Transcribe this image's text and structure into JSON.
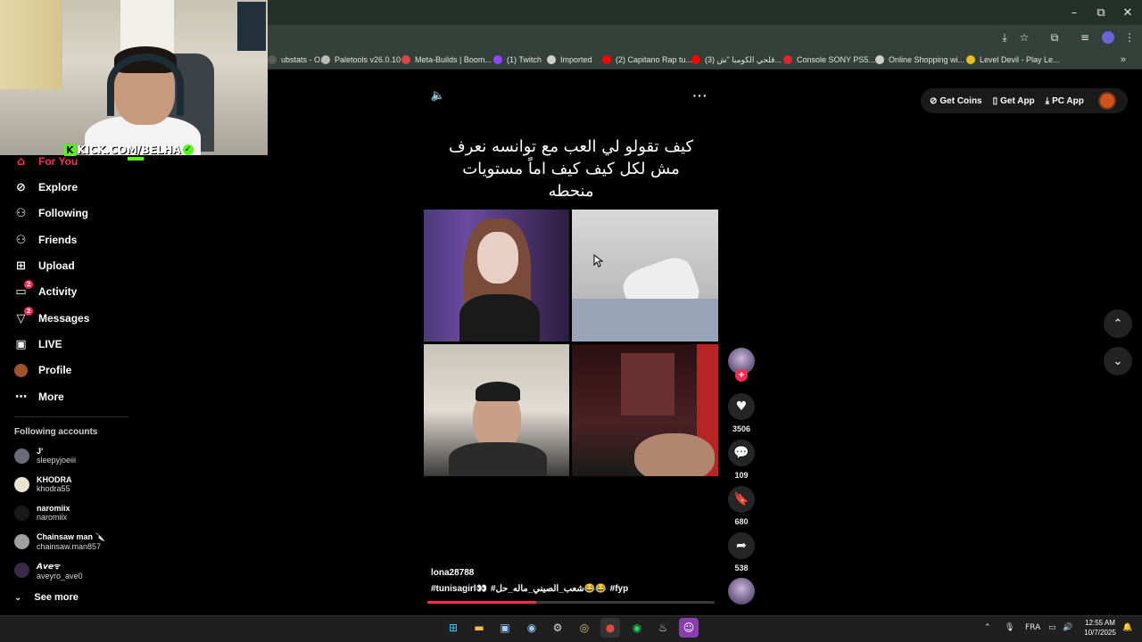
{
  "window": {
    "minimize": "–",
    "restore": "⧉",
    "close": "✕"
  },
  "bookmarks": [
    {
      "label": "ubstats - O...",
      "color": "#5a5a5a"
    },
    {
      "label": "Paletools v26.0.10",
      "color": "#bbbbbb"
    },
    {
      "label": "Meta-Builds | Boom...",
      "color": "#dd4444"
    },
    {
      "label": "(1) Twitch",
      "color": "#9146ff"
    },
    {
      "label": "Imported",
      "color": "#cfcfcf"
    },
    {
      "label": "(2) Capitano Rap tu...",
      "color": "#ff0000"
    },
    {
      "label": "(3) قلحي الكومبا \"ش...",
      "color": "#ff0000"
    },
    {
      "label": "Console SONY PS5...",
      "color": "#e0262f"
    },
    {
      "label": "Online Shopping wi...",
      "color": "#cfcfcf"
    },
    {
      "label": "Level Devil - Play Le...",
      "color": "#e8c21a"
    }
  ],
  "bookmarks_more": "»",
  "webcam": {
    "channel": "KICK.COM/BELHA",
    "k": "K"
  },
  "sidebar": {
    "items": [
      {
        "label": "For You",
        "icon": "home-icon"
      },
      {
        "label": "Explore",
        "icon": "compass-icon"
      },
      {
        "label": "Following",
        "icon": "following-icon"
      },
      {
        "label": "Friends",
        "icon": "friends-icon"
      },
      {
        "label": "Upload",
        "icon": "upload-icon"
      },
      {
        "label": "Activity",
        "icon": "activity-icon",
        "badge": "2"
      },
      {
        "label": "Messages",
        "icon": "messages-icon",
        "badge": "2"
      },
      {
        "label": "LIVE",
        "icon": "live-icon"
      },
      {
        "label": "Profile",
        "icon": "profile-icon"
      },
      {
        "label": "More",
        "icon": "more-icon"
      }
    ],
    "following_title": "Following accounts",
    "accounts": [
      {
        "name": "J'",
        "handle": "sleepyjoeiii",
        "color": "#6a6a7a"
      },
      {
        "name": "KHODRA",
        "handle": "khodra55",
        "color": "#e8e4d0"
      },
      {
        "name": "naromiix",
        "handle": "naromiix",
        "color": "#1a1a1a"
      },
      {
        "name": "Chainsaw man 🔪",
        "handle": "chainsaw.man857",
        "color": "#a0a0a0"
      },
      {
        "name": "𝘼𝙫𝙚ᯤ",
        "handle": "aveyro_ave0",
        "color": "#3a2a4a"
      }
    ],
    "see_more": "See more"
  },
  "topbar": {
    "coins": "Get Coins",
    "app": "Get App",
    "pc": "PC App"
  },
  "video": {
    "caption": "كيف تقولو لي العب مع توانسه نعرف مش لكل كيف كيف اماً مستويات منحطه",
    "author": "lona28788",
    "tags": [
      "#tunisagirl👀",
      "#شعب_الصيني_ماله_حل😂😂",
      "#fyp"
    ],
    "progress": 0.38
  },
  "actions": [
    {
      "name": "like",
      "icon": "♥",
      "count": "3506"
    },
    {
      "name": "comment",
      "icon": "💬",
      "count": "109"
    },
    {
      "name": "bookmark",
      "icon": "🔖",
      "count": "680"
    },
    {
      "name": "share",
      "icon": "➦",
      "count": "538"
    }
  ],
  "taskbar": {
    "lang": "FRA",
    "time": "12:55 AM",
    "date": "10/7/2025"
  }
}
